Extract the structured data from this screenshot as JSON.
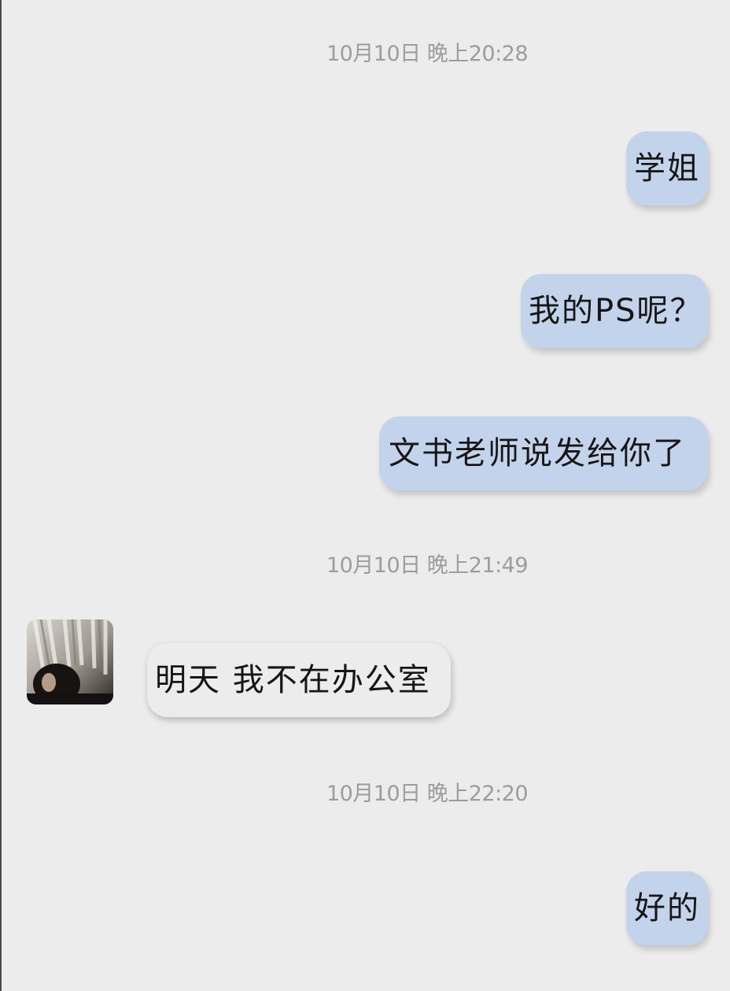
{
  "messages": [
    {
      "type": "timestamp",
      "text": "10月10日 晚上20:28"
    },
    {
      "type": "outgoing",
      "text": "学姐"
    },
    {
      "type": "outgoing",
      "text": "我的PS呢？"
    },
    {
      "type": "outgoing",
      "text": "文书老师说发给你了"
    },
    {
      "type": "timestamp",
      "text": "10月10日 晚上21:49"
    },
    {
      "type": "incoming",
      "text": "明天 我不在办公室",
      "avatar_icon": "avatar-photo"
    },
    {
      "type": "timestamp",
      "text": "10月10日 晚上22:20"
    },
    {
      "type": "outgoing",
      "text": "好的"
    }
  ],
  "colors": {
    "background": "#ececec",
    "outgoing_bubble": "#c4d3ec",
    "incoming_bubble": "#ececec",
    "timestamp_text": "#9c9c9c",
    "message_text": "#161616"
  }
}
